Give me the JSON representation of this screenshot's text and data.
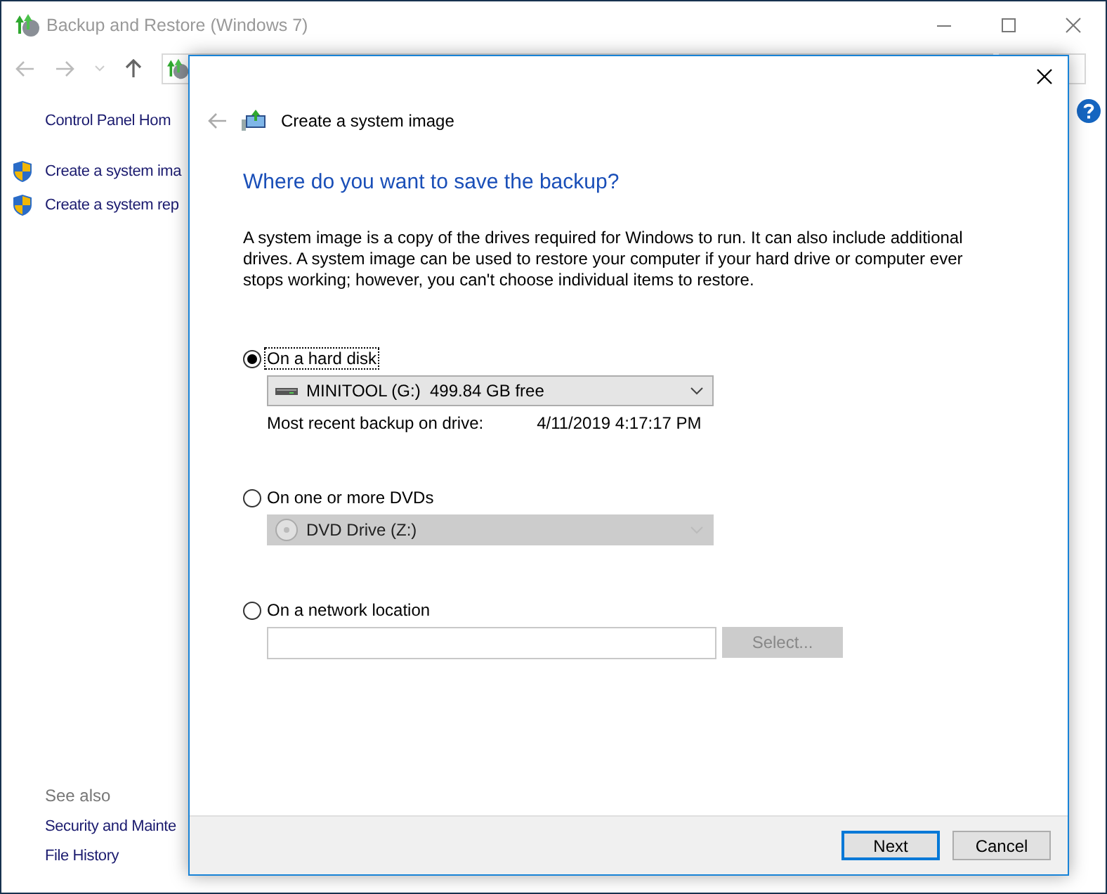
{
  "window": {
    "title": "Backup and Restore (Windows 7)"
  },
  "sidebar": {
    "home_link": "Control Panel Hom",
    "tasks": [
      {
        "label": "Create a system ima"
      },
      {
        "label": "Create a system rep"
      }
    ],
    "see_also": {
      "heading": "See also",
      "links": [
        "Security and Mainte",
        "File History"
      ]
    }
  },
  "dialog": {
    "title": "Create a system image",
    "heading": "Where do you want to save the backup?",
    "description": "A system image is a copy of the drives required for Windows to run. It can also include additional drives. A system image can be used to restore your computer if your hard drive or computer ever stops working; however, you can't choose individual items to restore.",
    "options": [
      {
        "label": "On a hard disk",
        "selected": true,
        "focused": true,
        "kind": "disk_select",
        "value": "MINITOOL (G:)  499.84 GB free",
        "disabled": false,
        "info_label": "Most recent backup on drive:",
        "info_value": "4/11/2019 4:17:17 PM"
      },
      {
        "label": "On one or more DVDs",
        "selected": false,
        "focused": false,
        "kind": "dvd_select",
        "value": "DVD Drive (Z:)",
        "disabled": true
      },
      {
        "label": "On a network location",
        "selected": false,
        "focused": false,
        "kind": "network",
        "button": {
          "label": "Select...",
          "disabled": true
        }
      }
    ],
    "buttons": [
      {
        "label": "Next",
        "default": true
      },
      {
        "label": "Cancel",
        "default": false
      }
    ]
  }
}
